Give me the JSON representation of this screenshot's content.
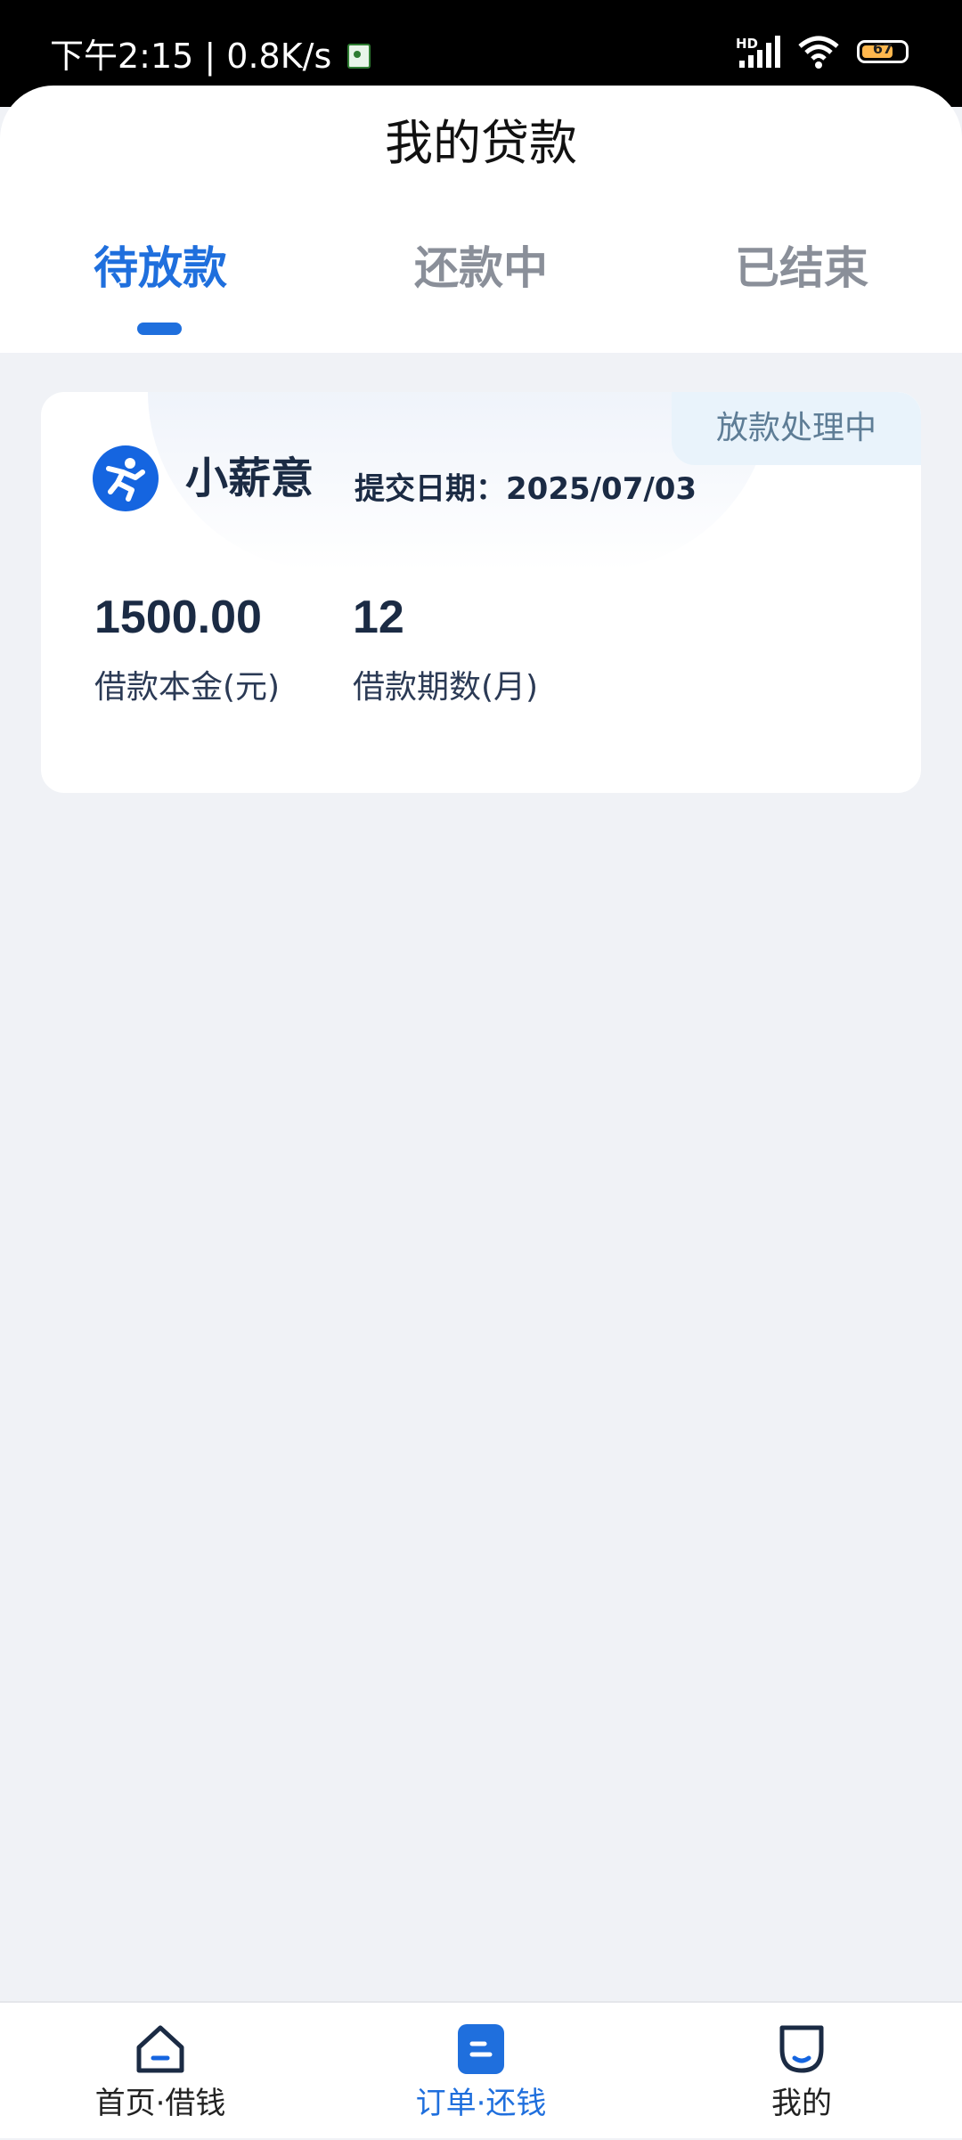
{
  "status_bar": {
    "time_speed": "下午2:15 | 0.8K/s",
    "network_label": "HD",
    "battery_level": "67"
  },
  "header": {
    "title": "我的贷款",
    "tabs": [
      {
        "label": "待放款",
        "active": true
      },
      {
        "label": "还款中",
        "active": false
      },
      {
        "label": "已结束",
        "active": false
      }
    ]
  },
  "loan_card": {
    "status": "放款处理中",
    "brand_name": "小薪意",
    "submit_date": "提交日期：2025/07/03",
    "principal_value": "1500.00",
    "principal_label": "借款本金(元)",
    "periods_value": "12",
    "periods_label": "借款期数(月)",
    "brand_color": "#1565e0"
  },
  "bottom_nav": {
    "items": [
      {
        "label": "首页·借钱",
        "icon": "home-icon",
        "active": false
      },
      {
        "label": "订单·还钱",
        "icon": "order-icon",
        "active": true
      },
      {
        "label": "我的",
        "icon": "profile-icon",
        "active": false
      }
    ],
    "accent": "#1f6fdd"
  }
}
